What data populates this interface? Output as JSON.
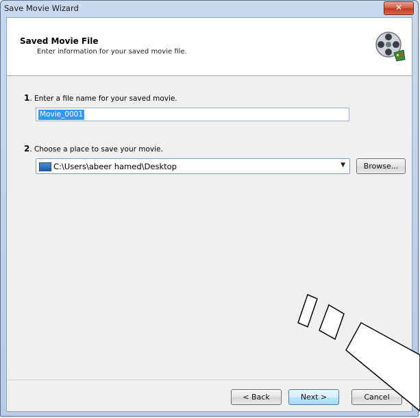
{
  "window": {
    "title": "Save Movie Wizard",
    "close_glyph": "✕"
  },
  "header": {
    "title": "Saved Movie File",
    "subtitle": "Enter information for your saved movie file.",
    "icon": "film-reel-icon"
  },
  "step1": {
    "number": "1",
    "label": "Enter a file name for your saved movie.",
    "value": "Movie_0001"
  },
  "step2": {
    "number": "2",
    "label": "Choose a place to save your movie.",
    "path": "C:\\Users\\abeer hamed\\Desktop",
    "browse_label": "Browse..."
  },
  "footer": {
    "back_label": "< Back",
    "next_label": "Next >",
    "cancel_label": "Cancel"
  }
}
